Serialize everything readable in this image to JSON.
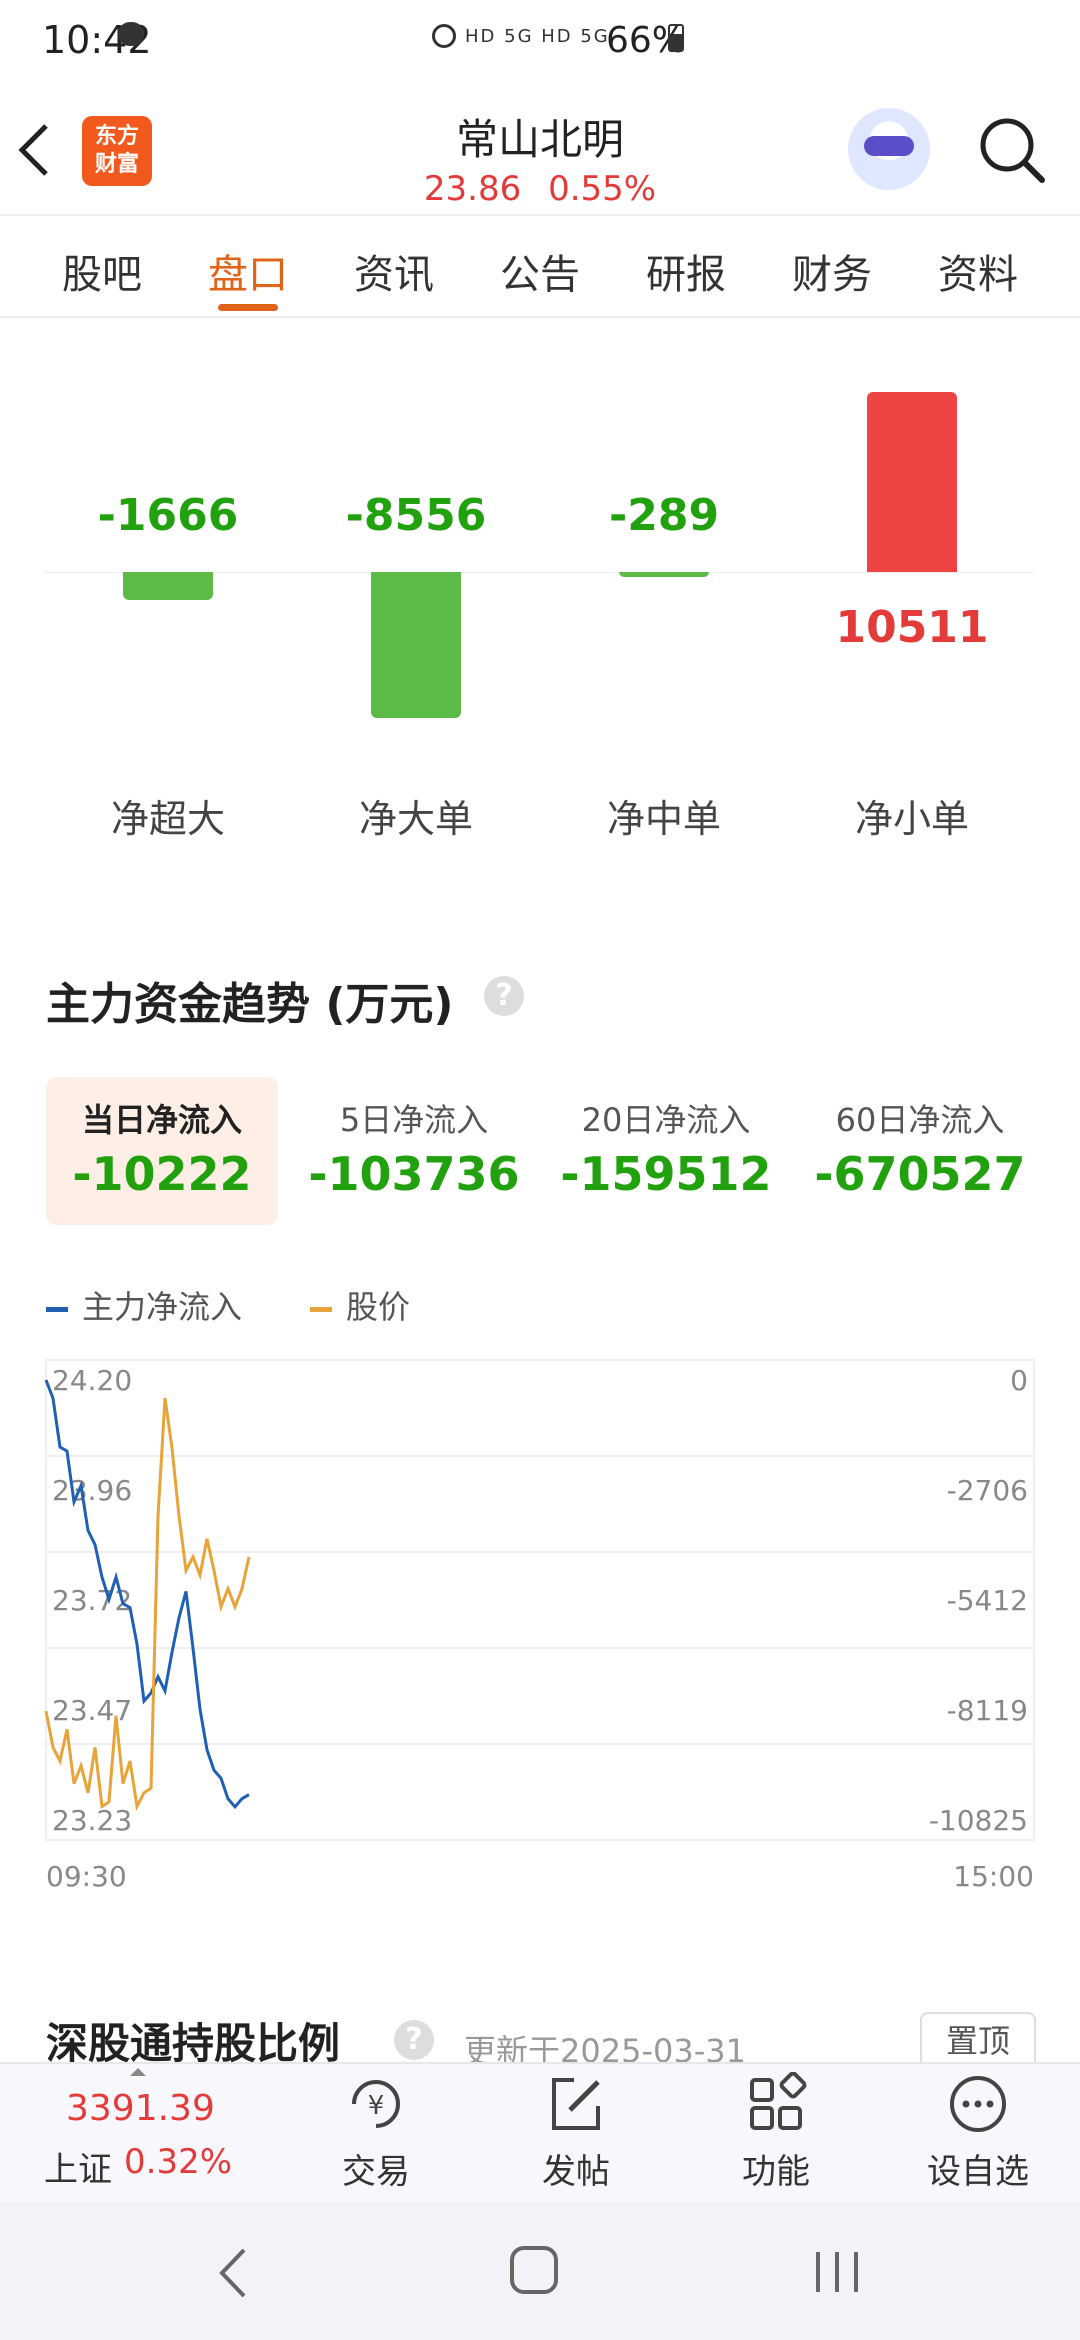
{
  "status_bar": {
    "time": "10:42",
    "indicators": "HD 5G HD 5G",
    "battery": "66%"
  },
  "header": {
    "logo_line1": "东方",
    "logo_line2": "财富",
    "stock_name": "常山北明",
    "price": "23.86",
    "change_pct": "0.55%"
  },
  "tabs": [
    {
      "label": "股吧"
    },
    {
      "label": "盘口"
    },
    {
      "label": "资讯"
    },
    {
      "label": "公告"
    },
    {
      "label": "研报"
    },
    {
      "label": "财务"
    },
    {
      "label": "资料"
    }
  ],
  "active_tab": "盘口",
  "net_flow": {
    "items": [
      {
        "label": "净超大",
        "value": "-1666",
        "num": -1666
      },
      {
        "label": "净大单",
        "value": "-8556",
        "num": -8556
      },
      {
        "label": "净中单",
        "value": "-289",
        "num": -289
      },
      {
        "label": "净小单",
        "value": "10511",
        "num": 10511
      }
    ]
  },
  "trend": {
    "title": "主力资金趋势 (万元)",
    "help": "?",
    "periods": [
      {
        "label": "当日净流入",
        "value": "-10222"
      },
      {
        "label": "5日净流入",
        "value": "-103736"
      },
      {
        "label": "20日净流入",
        "value": "-159512"
      },
      {
        "label": "60日净流入",
        "value": "-670527"
      }
    ],
    "legend_main": "主力净流入",
    "legend_price": "股价"
  },
  "chart_data": {
    "type": "line",
    "x_start": "09:30",
    "x_end": "15:00",
    "left_ticks": [
      "24.20",
      "23.96",
      "23.72",
      "23.47",
      "23.23"
    ],
    "right_ticks": [
      "0",
      "-2706",
      "-5412",
      "-8119",
      "-10825"
    ],
    "left_ylim": [
      23.23,
      24.2
    ],
    "right_ylim": [
      -10825,
      0
    ],
    "series": [
      {
        "name": "主力净流入",
        "color": "#1f5fb4",
        "axis": "right",
        "values": [
          0,
          -450,
          -1650,
          -1750,
          -3000,
          -2600,
          -3700,
          -4050,
          -4850,
          -5400,
          -4850,
          -5500,
          -5600,
          -6500,
          -7900,
          -7700,
          -7300,
          -7650,
          -6700,
          -5850,
          -5200,
          -6600,
          -8100,
          -9100,
          -9600,
          -9800,
          -10300,
          -10500,
          -10300,
          -10200
        ]
      },
      {
        "name": "股价",
        "color": "#e8a33a",
        "axis": "left",
        "values": [
          23.47,
          23.39,
          23.36,
          23.43,
          23.31,
          23.35,
          23.29,
          23.39,
          23.26,
          23.27,
          23.46,
          23.31,
          23.36,
          23.26,
          23.29,
          23.3,
          23.9,
          24.16,
          24.05,
          23.9,
          23.78,
          23.81,
          23.77,
          23.85,
          23.78,
          23.7,
          23.74,
          23.7,
          23.74,
          23.81
        ]
      }
    ]
  },
  "hk_connect": {
    "title": "深股通持股比例",
    "help": "?",
    "updated": "更新于2025-03-31",
    "pin": "置顶"
  },
  "bottom_nav": {
    "index_value": "3391.39",
    "index_name": "上证",
    "index_change": "0.32%",
    "items": [
      {
        "label": "交易"
      },
      {
        "label": "发帖"
      },
      {
        "label": "功能"
      },
      {
        "label": "设自选"
      }
    ]
  },
  "colors": {
    "up": "#e33a3a",
    "down": "#22a10f",
    "accent": "#e0641a",
    "bar_green": "#5cbb46",
    "bar_red": "#ee4444"
  }
}
